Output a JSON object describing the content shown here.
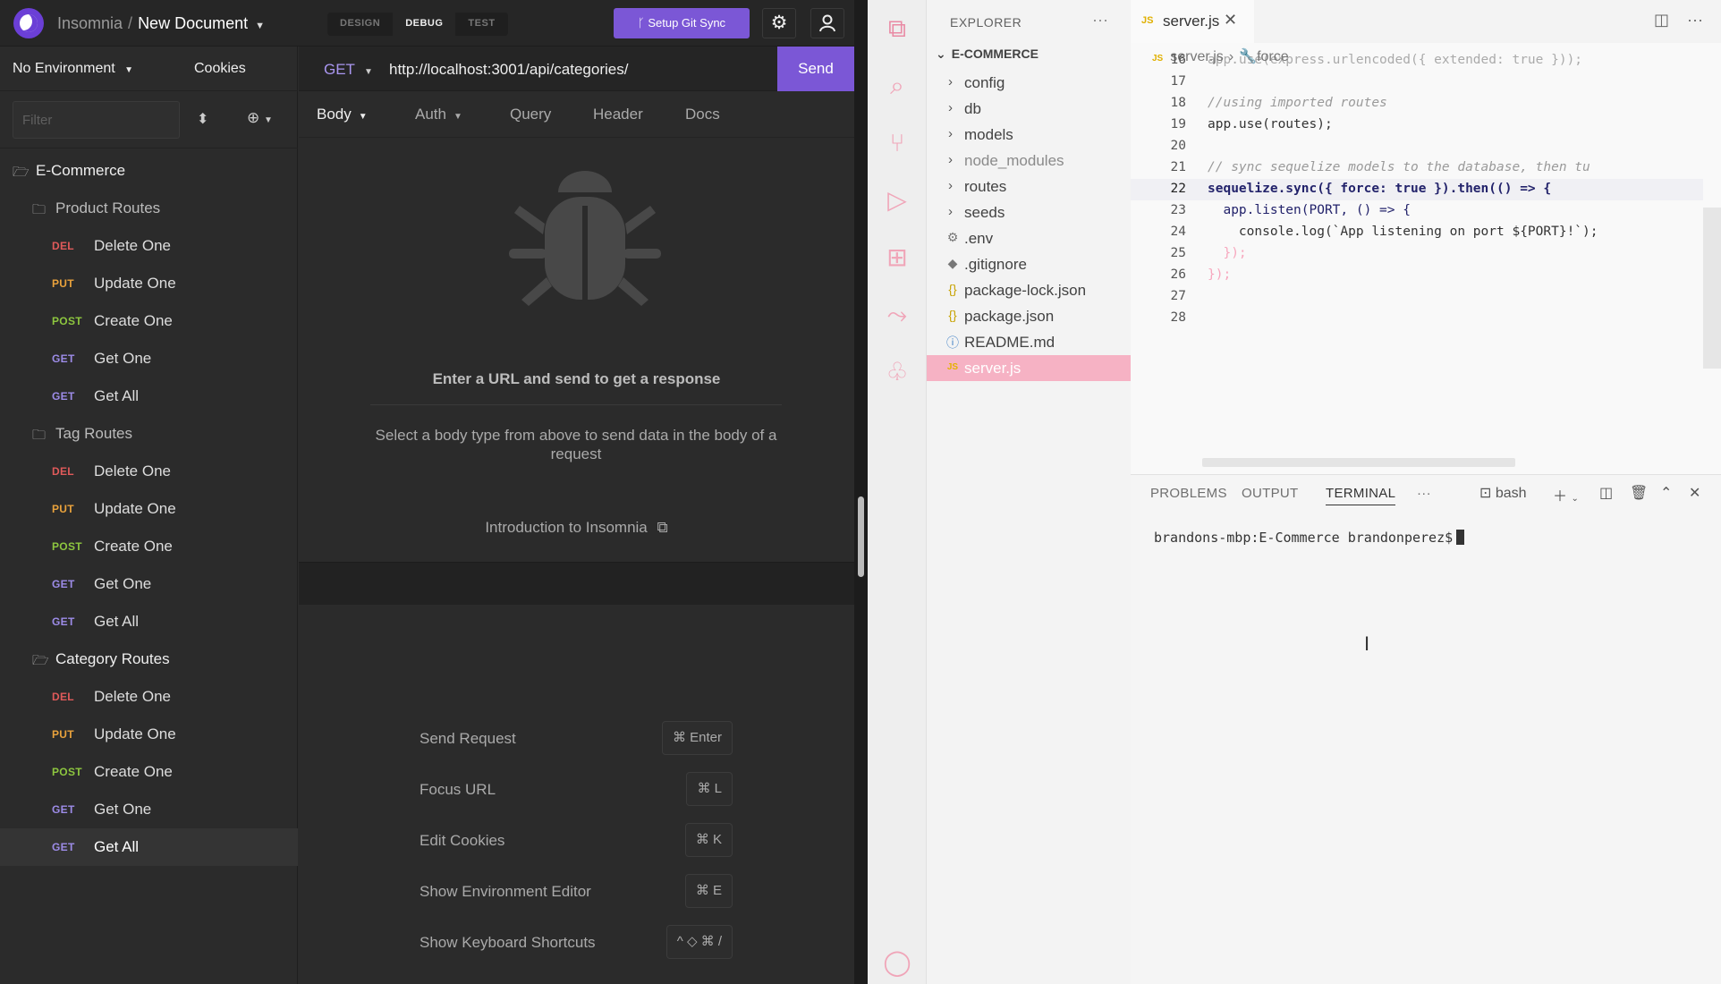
{
  "insomnia": {
    "app_name": "Insomnia",
    "document_name": "New Document",
    "modes": [
      "DESIGN",
      "DEBUG",
      "TEST"
    ],
    "active_mode": "DEBUG",
    "git_sync_label": "Setup Git Sync",
    "sidebar": {
      "environment": "No Environment",
      "cookies_label": "Cookies",
      "filter_placeholder": "Filter",
      "root_folder": "E-Commerce",
      "folders": [
        {
          "name": "Product Routes",
          "requests": [
            {
              "method": "DEL",
              "name": "Delete One"
            },
            {
              "method": "PUT",
              "name": "Update One"
            },
            {
              "method": "POST",
              "name": "Create One"
            },
            {
              "method": "GET",
              "name": "Get One"
            },
            {
              "method": "GET",
              "name": "Get All"
            }
          ]
        },
        {
          "name": "Tag Routes",
          "requests": [
            {
              "method": "DEL",
              "name": "Delete One"
            },
            {
              "method": "PUT",
              "name": "Update One"
            },
            {
              "method": "POST",
              "name": "Create One"
            },
            {
              "method": "GET",
              "name": "Get One"
            },
            {
              "method": "GET",
              "name": "Get All"
            }
          ]
        },
        {
          "name": "Category Routes",
          "requests": [
            {
              "method": "DEL",
              "name": "Delete One"
            },
            {
              "method": "PUT",
              "name": "Update One"
            },
            {
              "method": "POST",
              "name": "Create One"
            },
            {
              "method": "GET",
              "name": "Get One"
            },
            {
              "method": "GET",
              "name": "Get All"
            }
          ]
        }
      ]
    },
    "request": {
      "method": "GET",
      "url": "http://localhost:3001/api/categories/",
      "send_label": "Send",
      "tabs": [
        "Body",
        "Auth",
        "Query",
        "Header",
        "Docs"
      ],
      "empty_title": "Enter a URL and send to get a response",
      "body_hint": "Select a body type from above to send data in the body of a request",
      "intro_link": "Introduction to Insomnia"
    },
    "shortcuts": [
      {
        "label": "Send Request",
        "key": "⌘ Enter"
      },
      {
        "label": "Focus URL",
        "key": "⌘ L"
      },
      {
        "label": "Edit Cookies",
        "key": "⌘ K"
      },
      {
        "label": "Show Environment Editor",
        "key": "⌘ E"
      },
      {
        "label": "Show Keyboard Shortcuts",
        "key": "^ ◇ ⌘ /"
      }
    ]
  },
  "vscode": {
    "explorer_title": "EXPLORER",
    "root": "E-COMMERCE",
    "files": [
      {
        "name": "config",
        "type": "folder"
      },
      {
        "name": "db",
        "type": "folder"
      },
      {
        "name": "models",
        "type": "folder"
      },
      {
        "name": "node_modules",
        "type": "folder"
      },
      {
        "name": "routes",
        "type": "folder"
      },
      {
        "name": "seeds",
        "type": "folder"
      },
      {
        "name": ".env",
        "type": "gear"
      },
      {
        "name": ".gitignore",
        "type": "git"
      },
      {
        "name": "package-lock.json",
        "type": "json"
      },
      {
        "name": "package.json",
        "type": "json"
      },
      {
        "name": "README.md",
        "type": "info"
      },
      {
        "name": "server.js",
        "type": "js"
      }
    ],
    "active_tab": "server.js",
    "breadcrumb": [
      "server.js",
      "force"
    ],
    "code_lines": [
      {
        "n": "16",
        "text": "app.use(express.urlencoded({ extended: true }));"
      },
      {
        "n": "17",
        "text": ""
      },
      {
        "n": "18",
        "text": "//using imported routes"
      },
      {
        "n": "19",
        "text": "app.use(routes);"
      },
      {
        "n": "20",
        "text": ""
      },
      {
        "n": "21",
        "text": "// sync sequelize models to the database, then tu"
      },
      {
        "n": "22",
        "text": "sequelize.sync({ force: true }).then(() => {"
      },
      {
        "n": "23",
        "text": "  app.listen(PORT, () => {"
      },
      {
        "n": "24",
        "text": "    console.log(`App listening on port ${PORT}!`);"
      },
      {
        "n": "25",
        "text": "  });"
      },
      {
        "n": "26",
        "text": "});"
      },
      {
        "n": "27",
        "text": ""
      },
      {
        "n": "28",
        "text": ""
      }
    ],
    "panel_tabs": [
      "PROBLEMS",
      "OUTPUT",
      "TERMINAL"
    ],
    "active_panel_tab": "TERMINAL",
    "shell_name": "bash",
    "terminal_prompt": "brandons-mbp:E-Commerce brandonperez$"
  }
}
